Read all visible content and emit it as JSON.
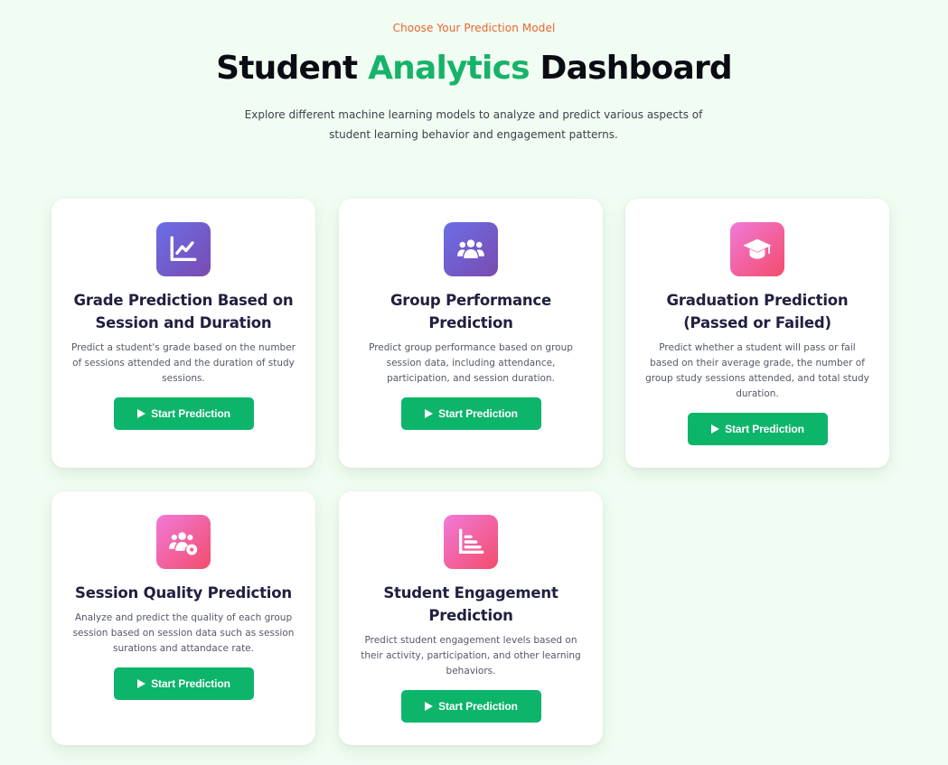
{
  "header": {
    "eyebrow": "Choose Your Prediction Model",
    "title_part1": "Student ",
    "title_accent": "Analytics",
    "title_part2": " Dashboard",
    "subtitle": "Explore different machine learning models to analyze and predict various aspects of student learning behavior and engagement patterns."
  },
  "colors": {
    "accent_green": "#16b36a",
    "eyebrow_orange": "#e8652f",
    "button_green": "#0db56a",
    "background": "#f1fdf2"
  },
  "cards": [
    {
      "icon": "line-chart-icon",
      "icon_color": "purple",
      "title": "Grade Prediction Based on Session and Duration",
      "description": "Predict a student's grade based on the number of sessions attended and the duration of study sessions.",
      "button": "Start Prediction"
    },
    {
      "icon": "users-icon",
      "icon_color": "purple",
      "title": "Group Performance Prediction",
      "description": "Predict group performance based on group session data, including attendance, participation, and session duration.",
      "button": "Start Prediction"
    },
    {
      "icon": "graduation-cap-icon",
      "icon_color": "pink",
      "title": "Graduation Prediction (Passed or Failed)",
      "description": "Predict whether a student will pass or fail based on their average grade, the number of group study sessions attended, and total study duration.",
      "button": "Start Prediction"
    },
    {
      "icon": "users-gear-icon",
      "icon_color": "pink",
      "title": "Session Quality Prediction",
      "description": "Analyze and predict the quality of each group session based on session data such as session surations and attandace rate.",
      "button": "Start Prediction"
    },
    {
      "icon": "bar-chart-list-icon",
      "icon_color": "pink",
      "title": "Student Engagement Prediction",
      "description": "Predict student engagement levels based on their activity, participation, and other learning behaviors.",
      "button": "Start Prediction"
    }
  ]
}
